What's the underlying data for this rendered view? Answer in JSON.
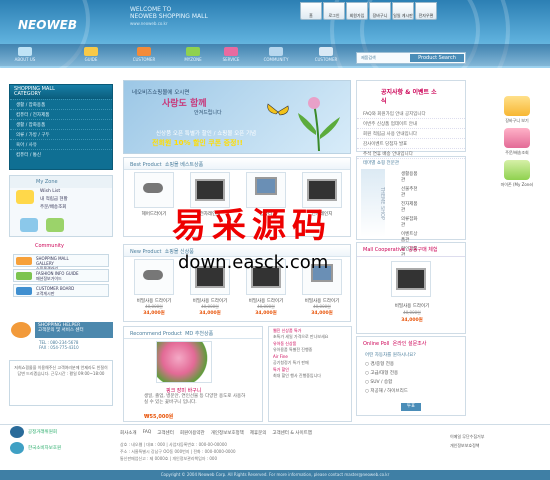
{
  "colors": {
    "brand": "#2c7fb3",
    "accent": "#c8387a",
    "price": "#e8550b",
    "category_bg": "#0f6f93"
  },
  "header": {
    "logo": "NEOWEB",
    "welcome": "WELCOME TO",
    "welcome_line2": "NEOWEB SHOPPING MALL",
    "url": "www.neoweb.co.kr",
    "top_menu": [
      "홈",
      "로그인",
      "회원가입",
      "장바구니",
      "일일 게시판",
      "전자우편"
    ],
    "nav": [
      "ABOUT US",
      "GUIDE",
      "CUSTOMER",
      "MYZONE",
      "SERVICE",
      "COMMUNITY",
      "CUSTOMER"
    ]
  },
  "category": {
    "title": "SHOPPING MALL",
    "subtitle": "CATEGORY",
    "items": [
      "생활 / 잡화용품",
      "컴퓨터 / 전자제품",
      "생활 / 잡화용품",
      "의류 / 가방 / 구두",
      "육아 / 사유",
      "컴퓨터 / 통신"
    ]
  },
  "myzone": {
    "title": "My Zone",
    "items": [
      "Wish List",
      "내 적립금 현황",
      "주문/배송조회"
    ]
  },
  "community": {
    "title": "Community",
    "items": [
      {
        "en": "SHOPPING MALL GALLERY",
        "ko": "쇼핑몰갤러리"
      },
      {
        "en": "FASHION INFO GUIDE",
        "ko": "패션정보가이드"
      },
      {
        "en": "CUSTOMER BOARD",
        "ko": "고객게시판"
      }
    ]
  },
  "helper": {
    "title": "SHOPPING HELPER",
    "line1": "고객문의 및 서비스 센터",
    "tel": "TEL : 080-234-5678",
    "fax": "FAX : 054-775-4310",
    "box": "저희쇼핑몰을 이용해주신 고객여러분께 언제라도 친절히 답변 드리겠습니다. 근무시간 : 평일 09:00~18:00"
  },
  "banner": {
    "line1": "네오비즈쇼핑몰에 오시면",
    "line2": "사랑도 함께",
    "line3": "안겨드립니다",
    "line4": "신상품 오픈 특별가 할인 / 쇼핑몰 오픈 기념",
    "line5": "전회원 10% 할인 쿠폰 증정!!"
  },
  "search": {
    "label": "제품검색",
    "button": "Product Search"
  },
  "news": {
    "title": "공지사항 & 이벤트 소식",
    "items": [
      "FAQ와 회원가입 안내 공지입니다",
      "이번주 신상품 업데이트 안내",
      "회원 적립금 사용 안내입니다",
      "감사이벤트 당첨자 발표",
      "추석 연휴 배송 안내입니다"
    ]
  },
  "best": {
    "title": "Best Product",
    "subtitle": "쇼핑몰 베스트상품",
    "products": [
      {
        "name": "헤어드라이기",
        "old": "",
        "price": ""
      },
      {
        "name": "전자레인지",
        "old": "",
        "price": ""
      },
      {
        "name": "컴퓨터",
        "old": "",
        "price": ""
      },
      {
        "name": "전자레인지",
        "old": "",
        "price": ""
      }
    ]
  },
  "newp": {
    "title": "New Product",
    "subtitle": "쇼핑몰 신상품",
    "products": [
      {
        "name": "비밀사용 드라이기",
        "old": "40,000원",
        "price": "34,000원"
      },
      {
        "name": "비밀사용 드라이기",
        "old": "40,000원",
        "price": "34,000원"
      },
      {
        "name": "비밀사용 드라이기",
        "old": "40,000원",
        "price": "34,000원"
      },
      {
        "name": "비밀사용 드라이기",
        "old": "40,000원",
        "price": "34,000원"
      }
    ]
  },
  "showroom": {
    "title": "테마별 쇼핑 전문관",
    "vertical": "THEME SHOP",
    "items": [
      "생활용품관",
      "선물추천관",
      "전자제품관",
      "의류잡화관",
      "이벤트상품관",
      "할인상품관"
    ]
  },
  "coop": {
    "title": "Mall Cooperative",
    "subtitle": "공동구매 체험",
    "name": "비밀사용 드라이기",
    "old": "40,000원",
    "price": "34,000원"
  },
  "survey": {
    "title": "Online Poll",
    "subtitle": "온라인 설문조사",
    "question": "어떤 자동차를 원하시나요?",
    "options": [
      "경/중형 전용",
      "고급/대형 전용",
      "SUV / 승합",
      "저공해 / 하이브리드"
    ],
    "button": "투표"
  },
  "far_right": [
    "장바구니 보기",
    "주문/배송조회",
    "마이존 (My Zone)"
  ],
  "reco": {
    "title": "Recommend Product",
    "subtitle": "MD 추천상품",
    "name": "핑크 장미 바구니",
    "desc": "생일, 졸업, 병문안, 연인선물 등 다양한 용도로 사용하실 수 있는 꽃바구니 입니다.",
    "price": "₩55,000원"
  },
  "events": [
    {
      "tag": "웹진 신상품 특가",
      "text": "초특가 세일 가격으로 만나보세요"
    },
    {
      "tag": "유아동 신상품",
      "text": "유아용품 특별전 진행중"
    },
    {
      "tag": "Air Fine",
      "text": "공기청정기 특가 판매"
    },
    {
      "tag": "특가 할인",
      "text": "최대 할인 행사 진행중입니다"
    }
  ],
  "footer": {
    "nav": [
      "회사소개",
      "FAQ",
      "고객센터",
      "회원이용약관",
      "개인정보보호정책",
      "제휴문의",
      "고객센터 & 사이트맵"
    ],
    "logo1": "공정거래위원회",
    "logo2": "한국소비자보호원",
    "info1": "상호 : 네오웹  |  대표 : 000  |  사업자등록번호 : 000-00-00000",
    "info2": "주소 : 서울특별시 강남구 OO동 000번지  |  전화 : 000-0000-0000",
    "info3": "통신판매업신고 : 제 0000호  |  개인정보관리책임자 : 000",
    "right1": "이메일 무단수집거부",
    "right2": "개인정보보호정책",
    "copyright": "Copyright © 2004 Neoweb Corp. All Rights Reserved.  For more information, please contact master@neoweb.co.kr"
  },
  "watermark": {
    "cn": "易采源码",
    "url": "down.easck.com"
  }
}
